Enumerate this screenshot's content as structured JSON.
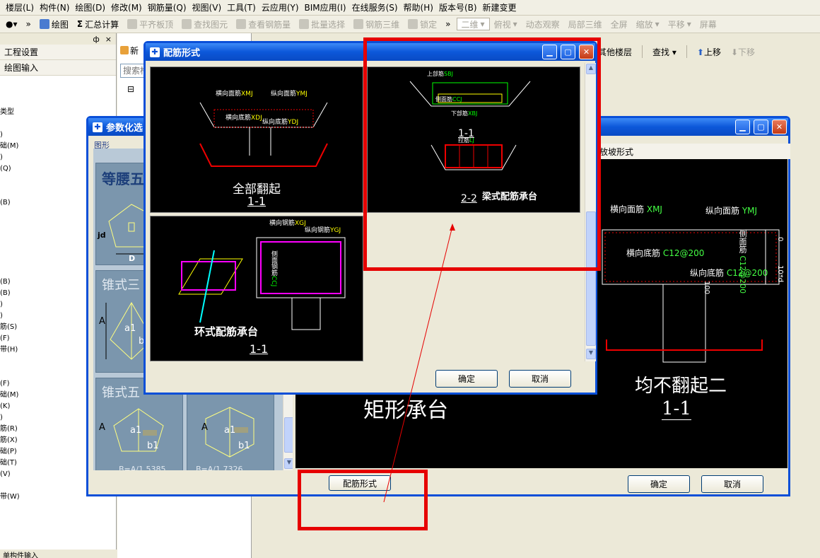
{
  "menubar": [
    "楼层(L)",
    "构件(N)",
    "绘图(D)",
    "修改(M)",
    "钢筋量(Q)",
    "视图(V)",
    "工具(T)",
    "云应用(Y)",
    "BIM应用(I)",
    "在线服务(S)",
    "帮助(H)",
    "版本号(B)",
    "新建变更"
  ],
  "toolbar": {
    "draw": "绘图",
    "sum_calc": "汇总计算",
    "items": [
      "平齐板顶",
      "查找图元",
      "查看钢筋量",
      "批量选择",
      "钢筋三维",
      "锁定"
    ],
    "view_select": "二维",
    "view_items": [
      "俯视",
      "动态观察",
      "局部三维",
      "全屏",
      "缩放",
      "平移",
      "屏幕"
    ]
  },
  "left_panel": {
    "pin": "ф",
    "close": "×",
    "items": [
      "工程设置",
      "绘图输入"
    ],
    "list": [
      "类型",
      "",
      ")",
      "础(M)",
      ")",
      "(Q)",
      "",
      "",
      "(B)",
      "",
      "",
      "",
      "",
      "",
      "",
      "(B)",
      "(B)",
      ")",
      ")",
      "筋(S)",
      "(F)",
      "带(H)",
      "",
      "",
      "(F)",
      "础(M)",
      "(K)",
      ")",
      "筋(R)",
      "筋(X)",
      "础(P)",
      "础(T)",
      "(V)",
      "",
      "带(W)"
    ],
    "bottom": "单构件输入"
  },
  "mid_panel": {
    "new_tab": "新",
    "search_placeholder": "搜索构",
    "tree_expand": "⊟"
  },
  "right_toolbar": {
    "other_floor": "其他楼层",
    "find": "查找",
    "move_up": "上移",
    "move_down": "下移"
  },
  "param_dialog": {
    "title": "参数化选",
    "tab": "图形",
    "shape_labels": [
      "等腰五",
      "锥式三",
      "锥式五"
    ],
    "dim_labels": {
      "jd": "jd",
      "D": "D",
      "A": "A",
      "a1": "a1",
      "b1": "b1",
      "b": "b"
    },
    "formula_1": "B=A/1.5385",
    "formula_2": "B=A/1.7326",
    "preview_tab": "放坡形式",
    "preview_labels": {
      "hx": "横向面筋",
      "hx_code": "XMJ",
      "zx": "纵向面筋",
      "zx_code": "YMJ",
      "hd": "横向底筋",
      "hd_code": "C12@200",
      "zd": "纵向底筋",
      "zd_code": "C12@200",
      "side": "侧面筋",
      "side_code": "C12@200",
      "dim_0": "0",
      "dim_10d": "10*d",
      "dim_100": "100"
    },
    "preview_caption": "均不翻起二",
    "preview_sub": "1-1",
    "left_caption": "矩形承台",
    "rebar_btn": "配筋形式",
    "ok": "确定",
    "cancel": "取消"
  },
  "rebar_dialog": {
    "title": "配筋形式",
    "cells": [
      {
        "caption": "全部翻起",
        "sub": "1-1",
        "labels": [
          "横向面筋",
          "XMJ",
          "纵向面筋",
          "YMJ",
          "横向底筋",
          "XDJ",
          "纵向底筋",
          "YDJ"
        ]
      },
      {
        "caption": "梁式配筋承台",
        "sub_top": "1-1",
        "sub": "2-2",
        "labels": [
          "上部筋",
          "SBJ",
          "侧面筋",
          "CCJ",
          "下部筋",
          "XBJ",
          "拉筋",
          "LJ"
        ]
      },
      {
        "caption": "环式配筋承台",
        "sub": "1-1",
        "labels": [
          "横向钢筋",
          "XGJ",
          "纵向钢筋",
          "YGJ",
          "侧面钢筋",
          "CCJ"
        ]
      }
    ],
    "ok": "确定",
    "cancel": "取消"
  },
  "annotation": {
    "highlight_color": "#e60000",
    "arrow_color": "#e60000"
  }
}
